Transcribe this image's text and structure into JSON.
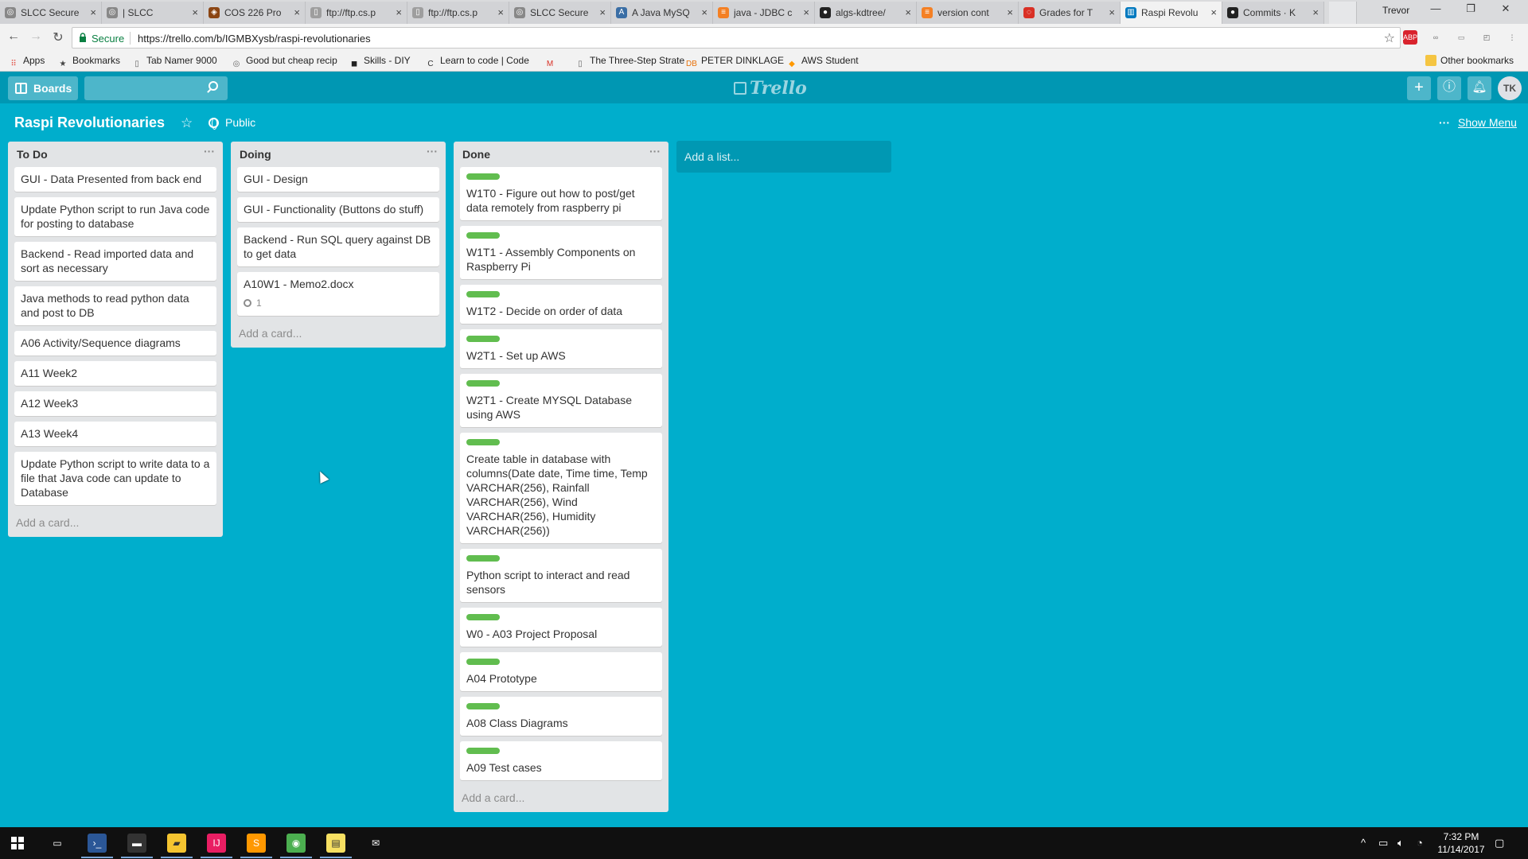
{
  "browser": {
    "tabs": [
      {
        "title": "SLCC Secure",
        "fav_color": "#888888",
        "fav_glyph": "◎"
      },
      {
        "title": "| SLCC",
        "fav_color": "#888888",
        "fav_glyph": "◎"
      },
      {
        "title": "COS 226 Pro",
        "fav_color": "#8b4513",
        "fav_glyph": "◈"
      },
      {
        "title": "ftp://ftp.cs.p",
        "fav_color": "#9e9e9e",
        "fav_glyph": "▯"
      },
      {
        "title": "ftp://ftp.cs.p",
        "fav_color": "#9e9e9e",
        "fav_glyph": "▯"
      },
      {
        "title": "SLCC Secure",
        "fav_color": "#888888",
        "fav_glyph": "◎"
      },
      {
        "title": "A Java MySQ",
        "fav_color": "#3a6ea5",
        "fav_glyph": "A"
      },
      {
        "title": "java - JDBC c",
        "fav_color": "#f48024",
        "fav_glyph": "≡"
      },
      {
        "title": "algs-kdtree/",
        "fav_color": "#222222",
        "fav_glyph": "●"
      },
      {
        "title": "version cont",
        "fav_color": "#f48024",
        "fav_glyph": "≡"
      },
      {
        "title": "Grades for T",
        "fav_color": "#d93025",
        "fav_glyph": "◌"
      },
      {
        "title": "Raspi Revolu",
        "fav_color": "#0079bf",
        "fav_glyph": "▥",
        "active": true
      },
      {
        "title": "Commits · K",
        "fav_color": "#222222",
        "fav_glyph": "●"
      }
    ],
    "profile_name": "Trevor",
    "secure_label": "Secure",
    "url": "https://trello.com/b/IGMBXysb/raspi-revolutionaries",
    "extensions": [
      {
        "name": "adblock",
        "text": "ABP",
        "bg": "#d9232d",
        "fg": "#ffffff"
      },
      {
        "name": "link",
        "text": "∞",
        "bg": "#f2f2f2",
        "fg": "#777777"
      },
      {
        "name": "screen",
        "text": "▭",
        "bg": "#f2f2f2",
        "fg": "#777777"
      },
      {
        "name": "cast",
        "text": "◰",
        "bg": "#f2f2f2",
        "fg": "#555555"
      },
      {
        "name": "menu",
        "text": "⋮",
        "bg": "#f2f2f2",
        "fg": "#555555"
      }
    ],
    "bookmarks": [
      {
        "label": "Apps",
        "icon": "⠿",
        "color": "#e04a3f"
      },
      {
        "label": "Bookmarks",
        "icon": "★",
        "color": "#444444"
      },
      {
        "label": "Tab Namer 9000",
        "icon": "▯",
        "color": "#666666"
      },
      {
        "label": "Good but cheap recip",
        "icon": "◎",
        "color": "#666666"
      },
      {
        "label": "Skills - DIY",
        "icon": "◼",
        "color": "#222222"
      },
      {
        "label": "Learn to code | Code",
        "icon": "C",
        "color": "#333333"
      },
      {
        "label": "",
        "icon": "M",
        "color": "#d93025"
      },
      {
        "label": "The Three-Step Strate",
        "icon": "▯",
        "color": "#666666"
      },
      {
        "label": "PETER DINKLAGE",
        "icon": "DB",
        "color": "#e8710a"
      },
      {
        "label": "AWS Student",
        "icon": "◆",
        "color": "#ff9900"
      }
    ],
    "other_bookmarks": "Other bookmarks"
  },
  "trello": {
    "boards_label": "Boards",
    "search_placeholder": "",
    "logo_text": "Trello",
    "avatar_initials": "TK",
    "board_title": "Raspi Revolutionaries",
    "visibility": "Public",
    "show_menu": "Show Menu",
    "add_list": "Add a list...",
    "add_card": "Add a card...",
    "lists": [
      {
        "title": "To Do",
        "cards": [
          {
            "text": "GUI - Data Presented from back end"
          },
          {
            "text": "Update Python script to run Java code for posting to database"
          },
          {
            "text": "Backend - Read imported data and sort as necessary"
          },
          {
            "text": "Java methods to read python data and post to DB"
          },
          {
            "text": "A06 Activity/Sequence diagrams"
          },
          {
            "text": "A11 Week2"
          },
          {
            "text": "A12 Week3"
          },
          {
            "text": "A13 Week4"
          },
          {
            "text": "Update Python script to write data to a file that Java code can update to Database"
          }
        ]
      },
      {
        "title": "Doing",
        "cards": [
          {
            "text": "GUI - Design"
          },
          {
            "text": "GUI - Functionality (Buttons do stuff)"
          },
          {
            "text": "Backend - Run SQL query against DB to get data"
          },
          {
            "text": "A10W1 - Memo2.docx",
            "attachments": "1"
          }
        ]
      },
      {
        "title": "Done",
        "cards": [
          {
            "text": "W1T0 - Figure out how to post/get data remotely from raspberry pi",
            "label_color": "#61bd4f"
          },
          {
            "text": "W1T1 - Assembly Components on Raspberry Pi",
            "label_color": "#61bd4f"
          },
          {
            "text": "W1T2 - Decide on order of data",
            "label_color": "#61bd4f"
          },
          {
            "text": "W2T1 - Set up AWS",
            "label_color": "#61bd4f"
          },
          {
            "text": "W2T1 - Create MYSQL Database using AWS",
            "label_color": "#61bd4f"
          },
          {
            "text": "Create table in database with columns(Date date, Time time, Temp VARCHAR(256), Rainfall VARCHAR(256), Wind VARCHAR(256), Humidity VARCHAR(256))",
            "label_color": "#61bd4f"
          },
          {
            "text": "Python script to interact and read sensors",
            "label_color": "#61bd4f"
          },
          {
            "text": "W0 - A03 Project Proposal",
            "label_color": "#61bd4f"
          },
          {
            "text": "A04 Prototype",
            "label_color": "#61bd4f"
          },
          {
            "text": "A08 Class Diagrams",
            "label_color": "#61bd4f"
          },
          {
            "text": "A09 Test cases",
            "label_color": "#61bd4f"
          }
        ]
      }
    ]
  },
  "taskbar": {
    "apps": [
      {
        "name": "task-view",
        "glyph": "▭",
        "bg": "#101010"
      },
      {
        "name": "powershell",
        "glyph": "›_",
        "bg": "#2b5797"
      },
      {
        "name": "terminal",
        "glyph": "▬",
        "bg": "#333333"
      },
      {
        "name": "file-explorer",
        "glyph": "▰",
        "bg": "#f4c430"
      },
      {
        "name": "intellij",
        "glyph": "IJ",
        "bg": "#e91e63"
      },
      {
        "name": "sublime",
        "glyph": "S",
        "bg": "#ff9800"
      },
      {
        "name": "chrome",
        "glyph": "◉",
        "bg": "#4caf50"
      },
      {
        "name": "sticky-notes",
        "glyph": "▤",
        "bg": "#f7e062"
      },
      {
        "name": "mail",
        "glyph": "✉",
        "bg": "#101010"
      }
    ],
    "time": "7:32 PM",
    "date": "11/14/2017"
  }
}
